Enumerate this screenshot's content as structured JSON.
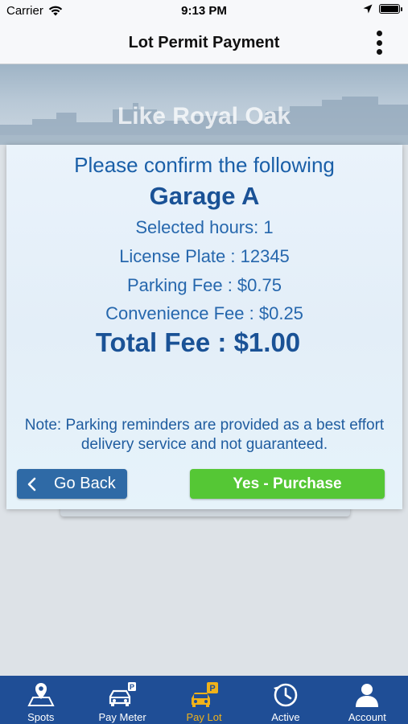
{
  "status_bar": {
    "carrier": "Carrier",
    "time": "9:13 PM"
  },
  "nav": {
    "title": "Lot Permit Payment"
  },
  "banner": {
    "text": "Like Royal Oak"
  },
  "confirm": {
    "heading": "Please confirm the following",
    "garage": "Garage A",
    "selected_hours": "Selected hours: 1",
    "license_plate": "License Plate : 12345",
    "parking_fee": "Parking Fee : $0.75",
    "convenience_fee": "Convenience Fee : $0.25",
    "total_fee": "Total Fee : $1.00",
    "note": "Note: Parking reminders are provided as a best effort delivery service and not guaranteed.",
    "back_label": "Go Back",
    "purchase_label": "Yes - Purchase"
  },
  "tabs": [
    {
      "label": "Spots",
      "icon": "map-pin-icon"
    },
    {
      "label": "Pay Meter",
      "icon": "car-parking-icon"
    },
    {
      "label": "Pay Lot",
      "icon": "car-parking-lot-icon"
    },
    {
      "label": "Active",
      "icon": "clock-history-icon"
    },
    {
      "label": "Account",
      "icon": "person-icon"
    }
  ],
  "colors": {
    "tab_bar": "#1f4e96",
    "active_tab": "#f0b21a",
    "back_button": "#2f6aa6",
    "purchase_button": "#55c735",
    "modal_text": "#1d5ea8"
  }
}
